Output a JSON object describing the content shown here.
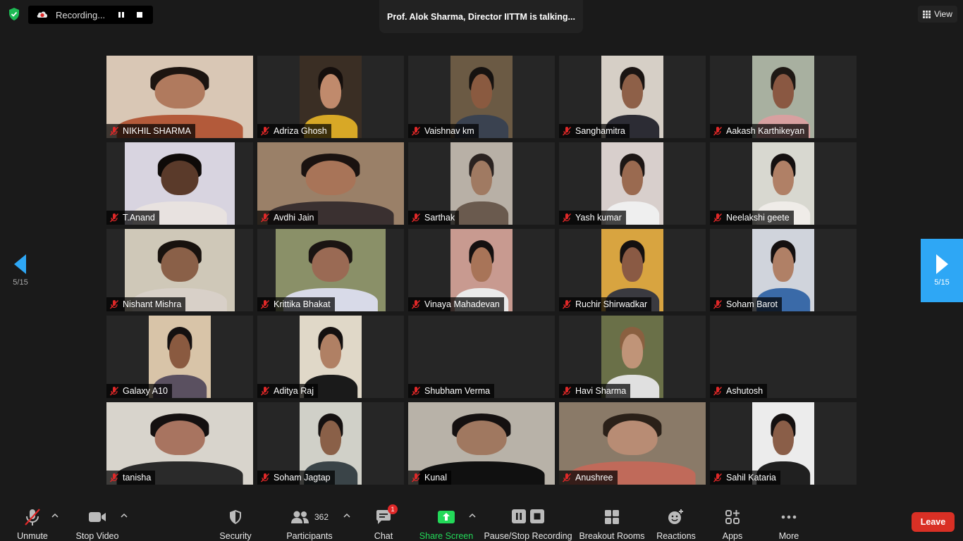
{
  "recording": {
    "label": "Recording..."
  },
  "speaker_banner": "Prof. Alok Sharma, Director IITTM is talking...",
  "view_button": "View",
  "pager": {
    "left": "5/15",
    "right": "5/15"
  },
  "participants": [
    {
      "name": "NIKHIL SHARMA",
      "bg": "#d9c7b5",
      "skin": "#b07a5e",
      "hair": "#1c1410",
      "shirt": "#b35a3a",
      "vw": 208
    },
    {
      "name": "Adriza Ghosh",
      "bg": "#3a2e24",
      "skin": "#c08a6c",
      "hair": "#140e0c",
      "shirt": "#d8a826",
      "vw": 88
    },
    {
      "name": "Vaishnav km",
      "bg": "#6b5a44",
      "skin": "#8a5a40",
      "hair": "#161210",
      "shirt": "#3a4250",
      "vw": 88
    },
    {
      "name": "Sanghamitra",
      "bg": "#d6cfc6",
      "skin": "#8e6048",
      "hair": "#1a1412",
      "shirt": "#2c2c34",
      "vw": 88
    },
    {
      "name": "Aakash Karthikeyan",
      "bg": "#a8b0a0",
      "skin": "#8a5842",
      "hair": "#1e1814",
      "shirt": "#d8a0a0",
      "vw": 88
    },
    {
      "name": "T.Anand",
      "bg": "#d8d4e0",
      "skin": "#5a3a2a",
      "hair": "#0e0a08",
      "shirt": "#e8e2e0",
      "vw": 156
    },
    {
      "name": "Avdhi Jain",
      "bg": "#9a8068",
      "skin": "#a87458",
      "hair": "#1a1210",
      "shirt": "#3a3030",
      "vw": 208
    },
    {
      "name": "Sarthak",
      "bg": "#b8b0a6",
      "skin": "#a07a62",
      "hair": "#2a2220",
      "shirt": "#6a5a4e",
      "vw": 88
    },
    {
      "name": "Yash kumar",
      "bg": "#d8cfcc",
      "skin": "#9a6a50",
      "hair": "#1c1614",
      "shirt": "#efefef",
      "vw": 88
    },
    {
      "name": "Neelakshi geete",
      "bg": "#d8d8d0",
      "skin": "#b08066",
      "hair": "#141010",
      "shirt": "#efece8",
      "vw": 88
    },
    {
      "name": "Nishant Mishra",
      "bg": "#cfc8b8",
      "skin": "#8a6048",
      "hair": "#18120e",
      "shirt": "#d8d0c8",
      "vw": 156
    },
    {
      "name": "Krittika Bhakat",
      "bg": "#8a9068",
      "skin": "#9a6a54",
      "hair": "#1a1412",
      "shirt": "#d8dae8",
      "vw": 156
    },
    {
      "name": "Vinaya Mahadevan",
      "bg": "#c89a90",
      "skin": "#a87458",
      "hair": "#141010",
      "shirt": "#eaeaea",
      "vw": 88
    },
    {
      "name": "Ruchir Shirwadkar",
      "bg": "#d8a440",
      "skin": "#8a5a44",
      "hair": "#141010",
      "shirt": "#3a3a40",
      "vw": 88
    },
    {
      "name": "Soham Barot",
      "bg": "#d0d4dc",
      "skin": "#b08066",
      "hair": "#141010",
      "shirt": "#3a6aa8",
      "vw": 88
    },
    {
      "name": "Galaxy A10",
      "bg": "#d8c4a8",
      "skin": "#8a5a40",
      "hair": "#141010",
      "shirt": "#5a5060",
      "vw": 88
    },
    {
      "name": "Aditya Raj",
      "bg": "#e0d8c8",
      "skin": "#b08064",
      "hair": "#141010",
      "shirt": "#1a1a1a",
      "vw": 88
    },
    {
      "name": "Shubham Verma",
      "bg": "#262626",
      "skin": "#262626",
      "hair": "#262626",
      "shirt": "#262626",
      "vw": 0
    },
    {
      "name": "Havi Sharma",
      "bg": "#6a7048",
      "skin": "#c09478",
      "hair": "#8a6040",
      "shirt": "#e0e0e0",
      "vw": 88
    },
    {
      "name": "Ashutosh",
      "bg": "#262626",
      "skin": "#262626",
      "hair": "#262626",
      "shirt": "#262626",
      "vw": 0
    },
    {
      "name": "tanisha",
      "bg": "#d8d4cc",
      "skin": "#a87460",
      "hair": "#141010",
      "shirt": "#2a2a2a",
      "vw": 208
    },
    {
      "name": "Soham Jagtap",
      "bg": "#d0d0c8",
      "skin": "#8a6048",
      "hair": "#141010",
      "shirt": "#3a4448",
      "vw": 88
    },
    {
      "name": "Kunal",
      "bg": "#b8b2a8",
      "skin": "#a07860",
      "hair": "#141010",
      "shirt": "#101010",
      "vw": 208
    },
    {
      "name": "Anushree",
      "bg": "#8a7a68",
      "skin": "#b88c74",
      "hair": "#2a2018",
      "shirt": "#c06a5a",
      "vw": 208
    },
    {
      "name": "Sahil Kataria",
      "bg": "#ececec",
      "skin": "#8a5e48",
      "hair": "#141010",
      "shirt": "#202020",
      "vw": 88
    }
  ],
  "toolbar": {
    "unmute": "Unmute",
    "stop_video": "Stop Video",
    "security": "Security",
    "participants": "Participants",
    "participants_count": "362",
    "chat": "Chat",
    "chat_badge": "1",
    "share_screen": "Share Screen",
    "pause_stop_recording": "Pause/Stop Recording",
    "breakout_rooms": "Breakout Rooms",
    "reactions": "Reactions",
    "apps": "Apps",
    "more": "More",
    "leave": "Leave"
  },
  "colors": {
    "share_green": "#23d959",
    "leave_red": "#d93025",
    "pager_blue": "#2ea7f5"
  }
}
